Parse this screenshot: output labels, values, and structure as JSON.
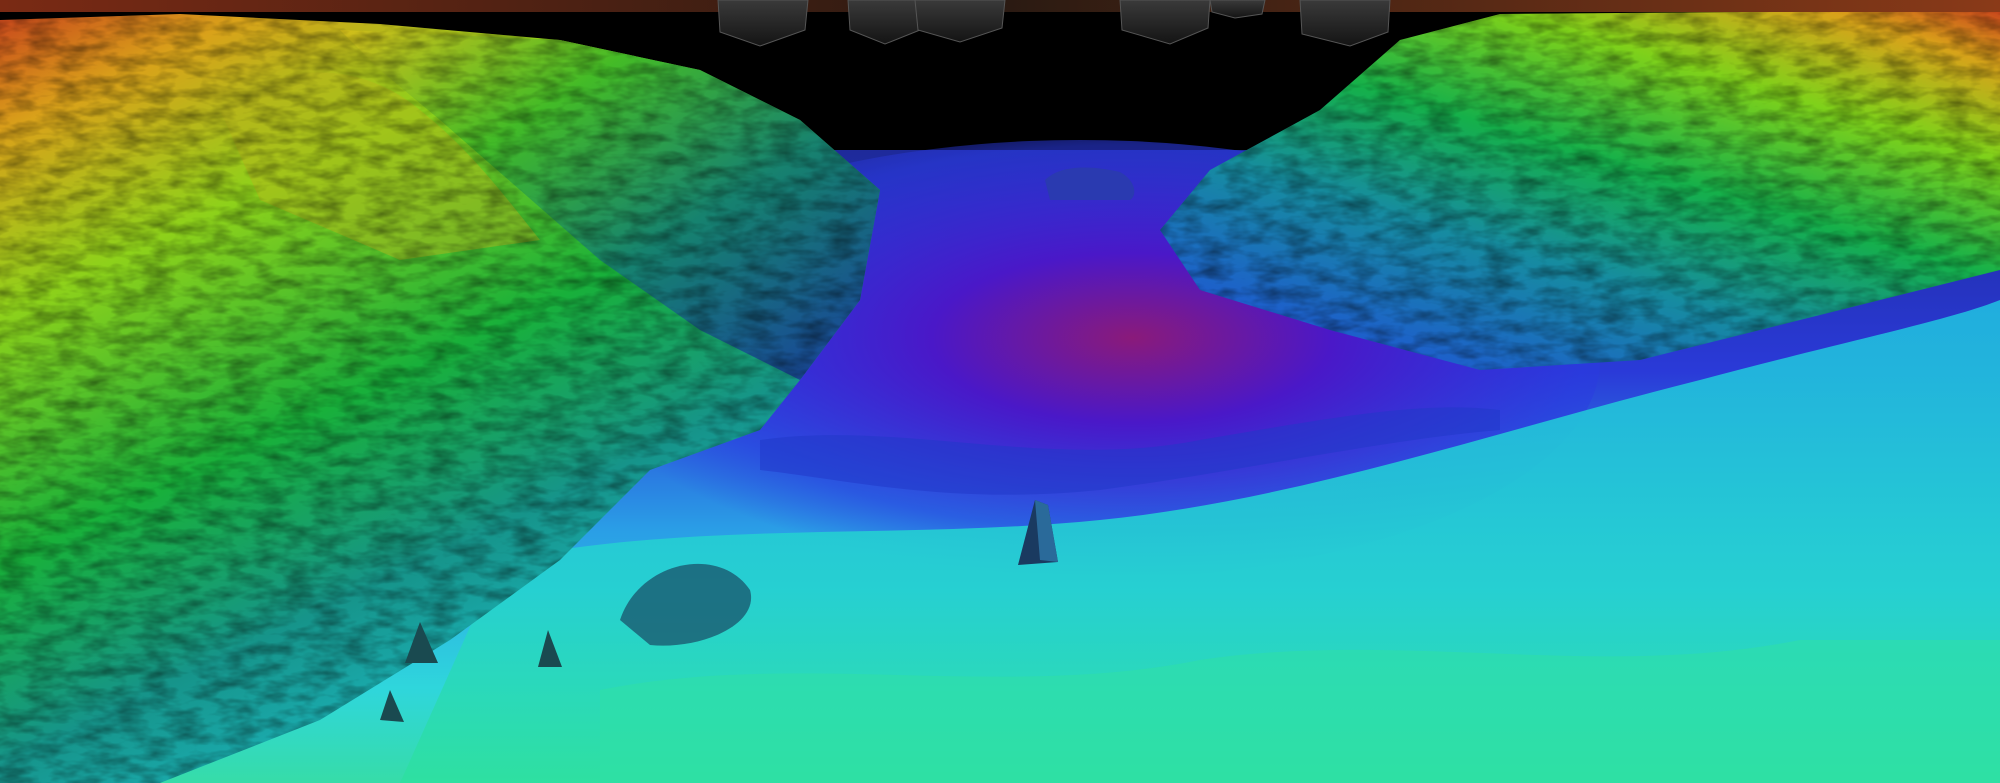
{
  "scene": {
    "kind": "bathymetric-3d-render",
    "color_ramp": [
      "#b22222",
      "#e8671a",
      "#d9c21a",
      "#6bd11a",
      "#14b83a",
      "#16a89a",
      "#1fd0e0",
      "#2a55e8",
      "#3a1ad6",
      "#8a1a8a"
    ],
    "colors": {
      "sky": "#000000",
      "top_band": "#6a2a14",
      "structure": "#2a2a2a"
    },
    "features": [
      "left-ridge",
      "right-ridge",
      "central-basin",
      "seabed-pinnacles",
      "surface-structures"
    ]
  }
}
